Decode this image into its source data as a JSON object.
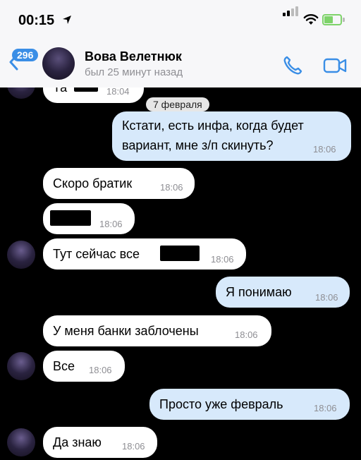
{
  "status": {
    "time": "00:15"
  },
  "header": {
    "back_count": "296",
    "contact_name": "Вова Велетнюк",
    "last_seen": "был 25 минут назад"
  },
  "chat": {
    "date_divider": "7 февраля",
    "messages": [
      {
        "dir": "in",
        "text": "Та",
        "time": "18:04"
      },
      {
        "dir": "out",
        "text_line1": "Кстати, есть инфа, когда будет",
        "text_line2": "вариант, мне з/п скинуть?",
        "time": "18:06"
      },
      {
        "dir": "in",
        "text": "Скоро братик",
        "time": "18:06"
      },
      {
        "dir": "in",
        "text": "",
        "time": "18:06"
      },
      {
        "dir": "in",
        "text": "Тут сейчас все",
        "time": "18:06"
      },
      {
        "dir": "out",
        "text": "Я понимаю",
        "time": "18:06"
      },
      {
        "dir": "in",
        "text": "У меня банки заблочены",
        "time": "18:06"
      },
      {
        "dir": "in",
        "text": "Все",
        "time": "18:06"
      },
      {
        "dir": "out",
        "text": "Просто уже февраль",
        "time": "18:06"
      },
      {
        "dir": "in",
        "text": "Да знаю",
        "time": "18:06"
      }
    ]
  }
}
